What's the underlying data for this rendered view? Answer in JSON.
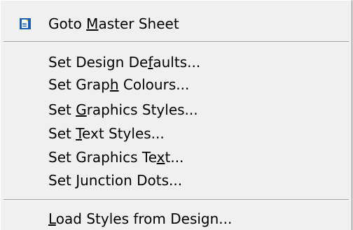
{
  "menu": {
    "items": [
      {
        "pre": "Goto ",
        "mn": "M",
        "post": "aster Sheet",
        "icon": "document-icon",
        "colors": {
          "icon_fill": "#1a5fb4",
          "icon_page": "#ffffff",
          "icon_accent": "#e8c200"
        }
      },
      {
        "pre": "Set Design De",
        "mn": "f",
        "post": "aults..."
      },
      {
        "pre": "Set Grap",
        "mn": "h",
        "post": " Colours..."
      },
      {
        "pre": "Set ",
        "mn": "G",
        "post": "raphics Styles..."
      },
      {
        "pre": "Set ",
        "mn": "T",
        "post": "ext Styles..."
      },
      {
        "pre": "Set Graphics Te",
        "mn": "x",
        "post": "t..."
      },
      {
        "pre": "Set ",
        "mn": "J",
        "post": "unction Dots..."
      },
      {
        "pre": "",
        "mn": "L",
        "post": "oad Styles from Design..."
      }
    ]
  }
}
